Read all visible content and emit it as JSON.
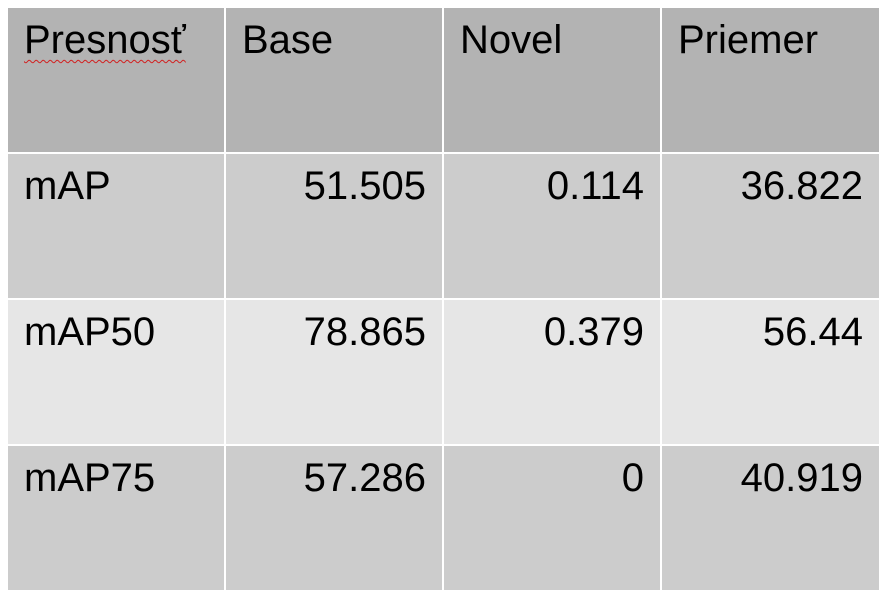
{
  "table": {
    "headers": [
      "Presnosť",
      "Base",
      "Novel",
      "Priemer"
    ],
    "rows": [
      {
        "label": "mAP",
        "values": [
          "51.505",
          "0.114",
          "36.822"
        ]
      },
      {
        "label": "mAP50",
        "values": [
          "78.865",
          "0.379",
          "56.44"
        ]
      },
      {
        "label": "mAP75",
        "values": [
          "57.286",
          "0",
          "40.919"
        ]
      }
    ]
  },
  "colors": {
    "header_bg": "#b3b3b3",
    "row_dark_bg": "#cccccc",
    "row_light_bg": "#e6e6e6",
    "spellcheck_underline": "#d21f1f"
  }
}
